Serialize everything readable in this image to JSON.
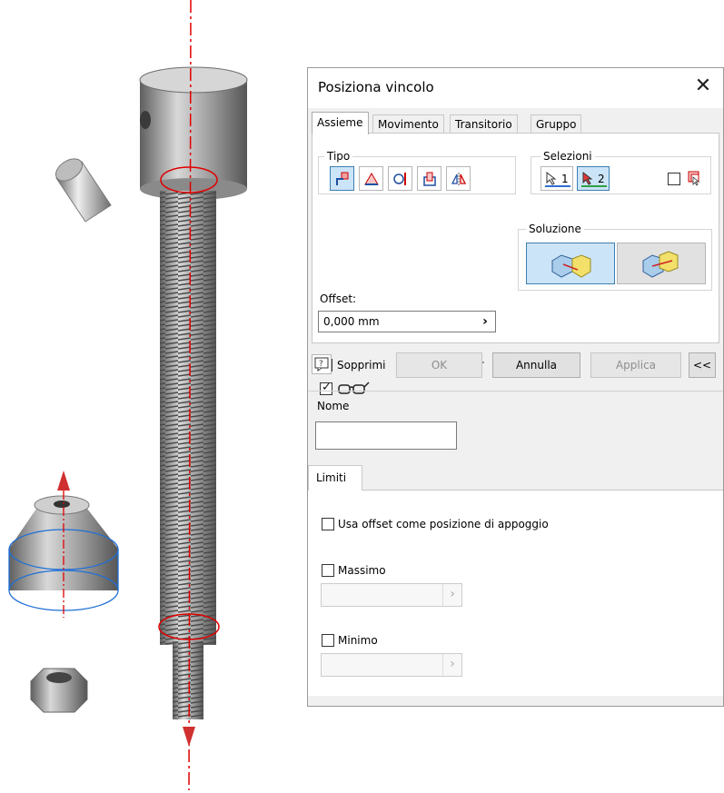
{
  "dialog": {
    "title": "Posiziona vincolo",
    "tabs": [
      "Assieme",
      "Movimento",
      "Transitorio",
      "Gruppo vincoli"
    ],
    "active_tab": "Assieme",
    "tipo": {
      "label": "Tipo",
      "buttons": [
        "mate-icon",
        "angle-icon",
        "tangent-icon",
        "insert-icon",
        "symmetry-icon"
      ],
      "selected": "mate-icon"
    },
    "selezioni": {
      "label": "Selezioni",
      "sel1_label": "1",
      "sel2_label": "2",
      "selected": "2",
      "first_occurrence_checked": false
    },
    "offset": {
      "label": "Offset:",
      "value": "0,000 mm"
    },
    "soluzione": {
      "label": "Soluzione",
      "selected": "mate"
    },
    "sopprimi": {
      "label": "Sopprimi",
      "checked": false
    },
    "pick_part_first_checked": false,
    "preview_checked": true,
    "buttons": {
      "ok": "OK",
      "annulla": "Annulla",
      "applica": "Applica",
      "more": "<<"
    },
    "nome": {
      "label": "Nome",
      "value": ""
    },
    "limiti": {
      "tab_label": "Limiti",
      "usa_offset_label": "Usa offset come posizione di appoggio",
      "usa_offset_checked": false,
      "massimo_label": "Massimo",
      "massimo_checked": false,
      "minimo_label": "Minimo",
      "minimo_checked": false
    }
  },
  "colors": {
    "accent": "#3c7fb1",
    "axis_red": "#e00000",
    "highlight_blue": "#1f6fd6",
    "metal": "#9a9a9a"
  }
}
